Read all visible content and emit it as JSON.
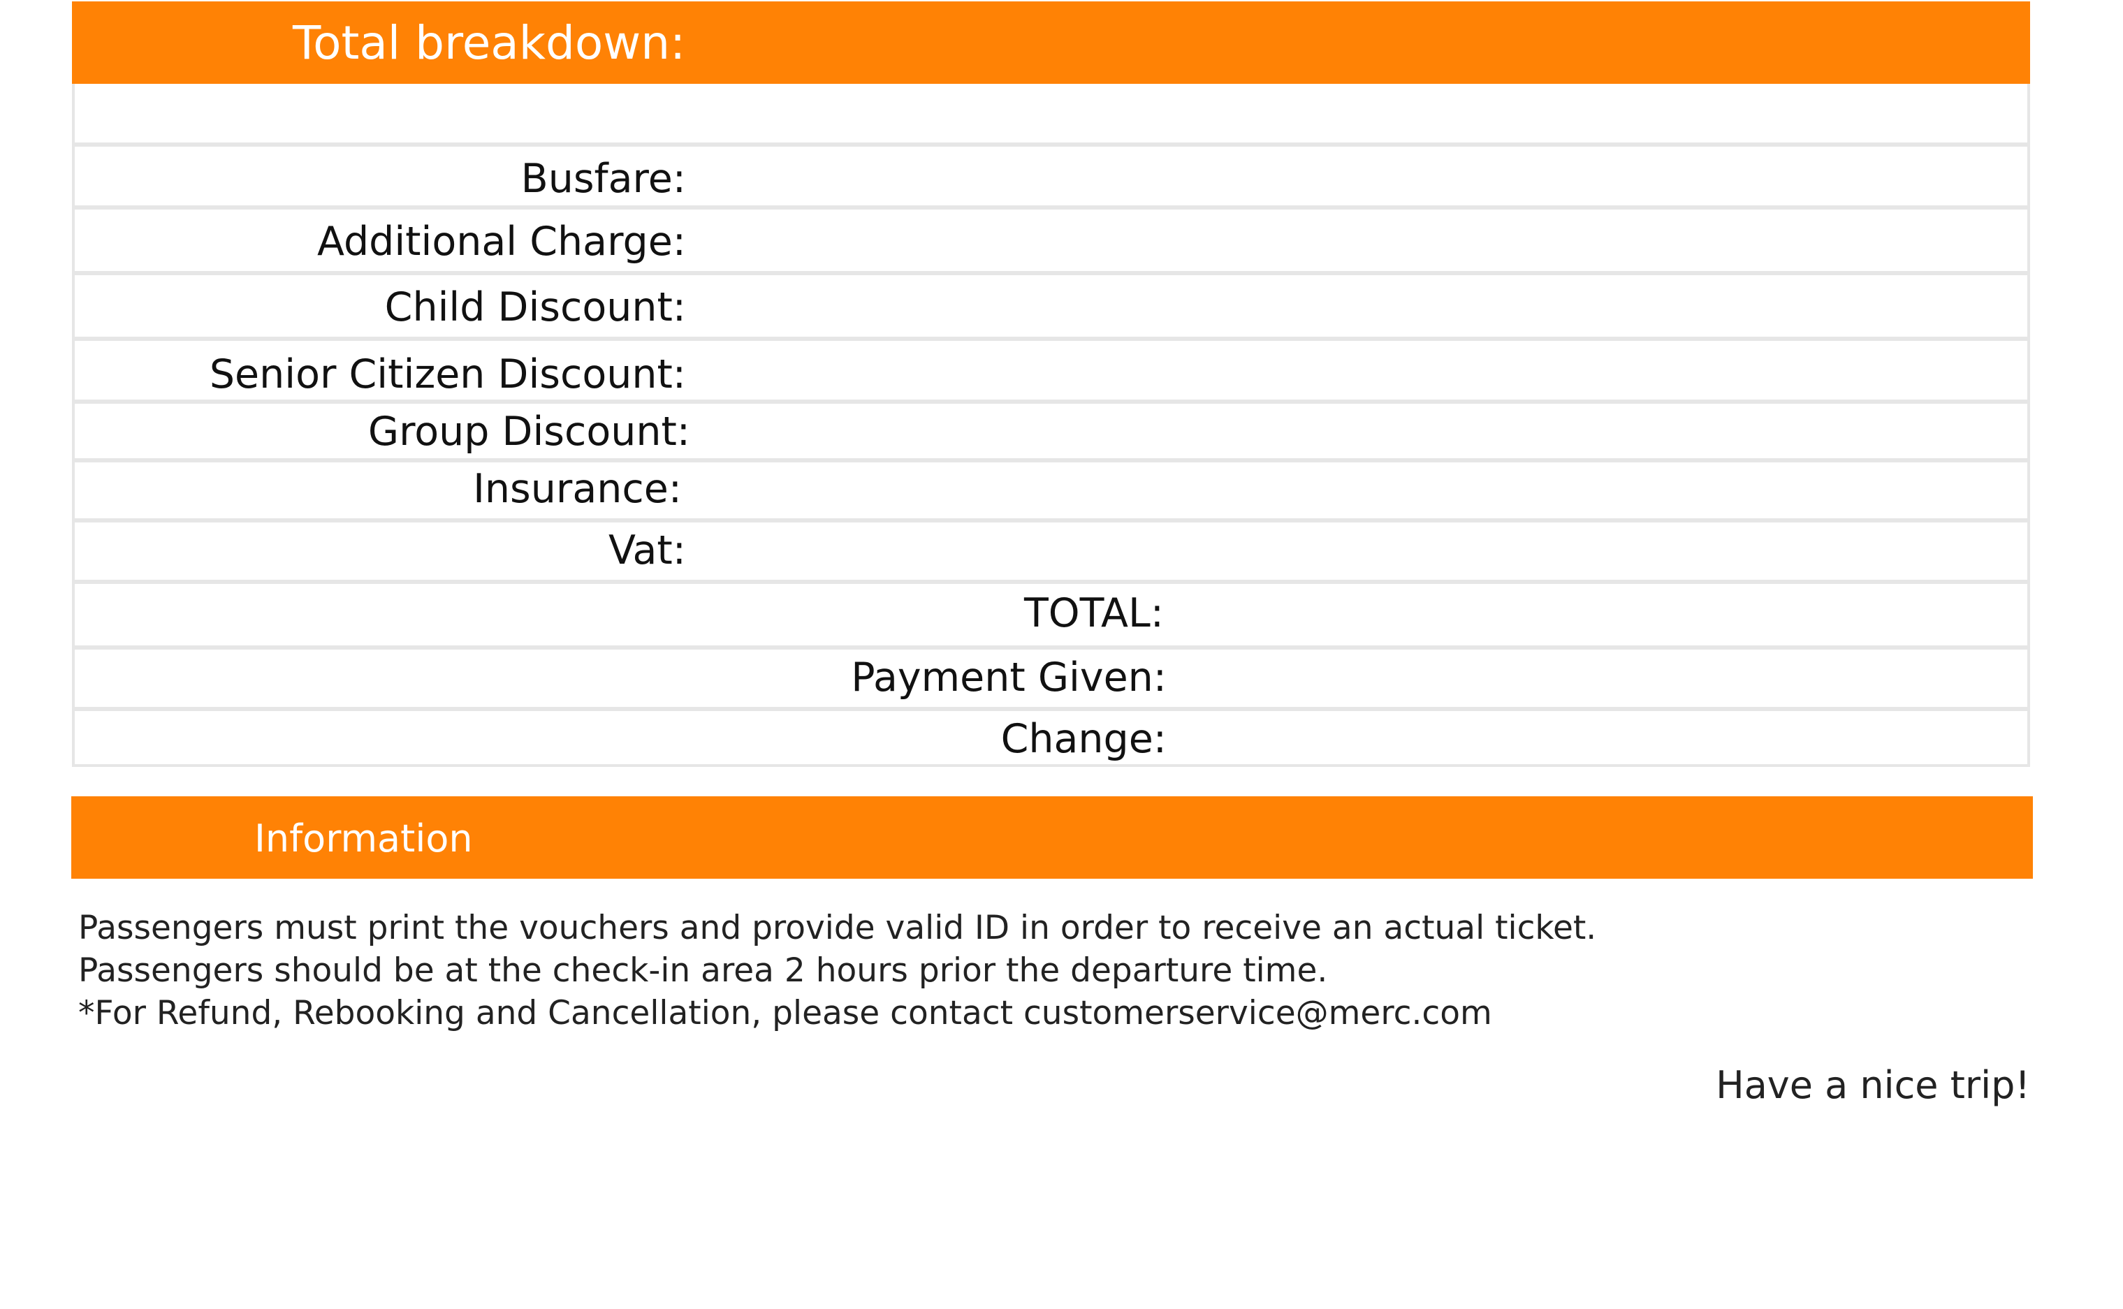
{
  "breakdown": {
    "title": "Total breakdown:",
    "rows": [
      {
        "label": "",
        "value": ""
      },
      {
        "label": "Busfare:",
        "value": ""
      },
      {
        "label": "Additional Charge:",
        "value": ""
      },
      {
        "label": "Child Discount:",
        "value": ""
      },
      {
        "label": "Senior Citizen Discount:",
        "value": ""
      },
      {
        "label": "Group Discount:",
        "value": ""
      },
      {
        "label": "Insurance:",
        "value": ""
      },
      {
        "label": "Vat:",
        "value": ""
      },
      {
        "label": "TOTAL:",
        "value": ""
      },
      {
        "label": "Payment Given:",
        "value": ""
      },
      {
        "label": "Change:",
        "value": ""
      }
    ]
  },
  "information": {
    "title": "Information",
    "lines": [
      "Passengers must print the vouchers and provide valid ID in order to receive an actual ticket.",
      "Passengers should be at the check-in area 2 hours prior the departure time.",
      "*For Refund, Rebooking and Cancellation, please contact customerservice@merc.com"
    ],
    "farewell": "Have a nice trip!"
  },
  "colors": {
    "accent": "#ff8205",
    "row_border": "#e6e6e6"
  }
}
